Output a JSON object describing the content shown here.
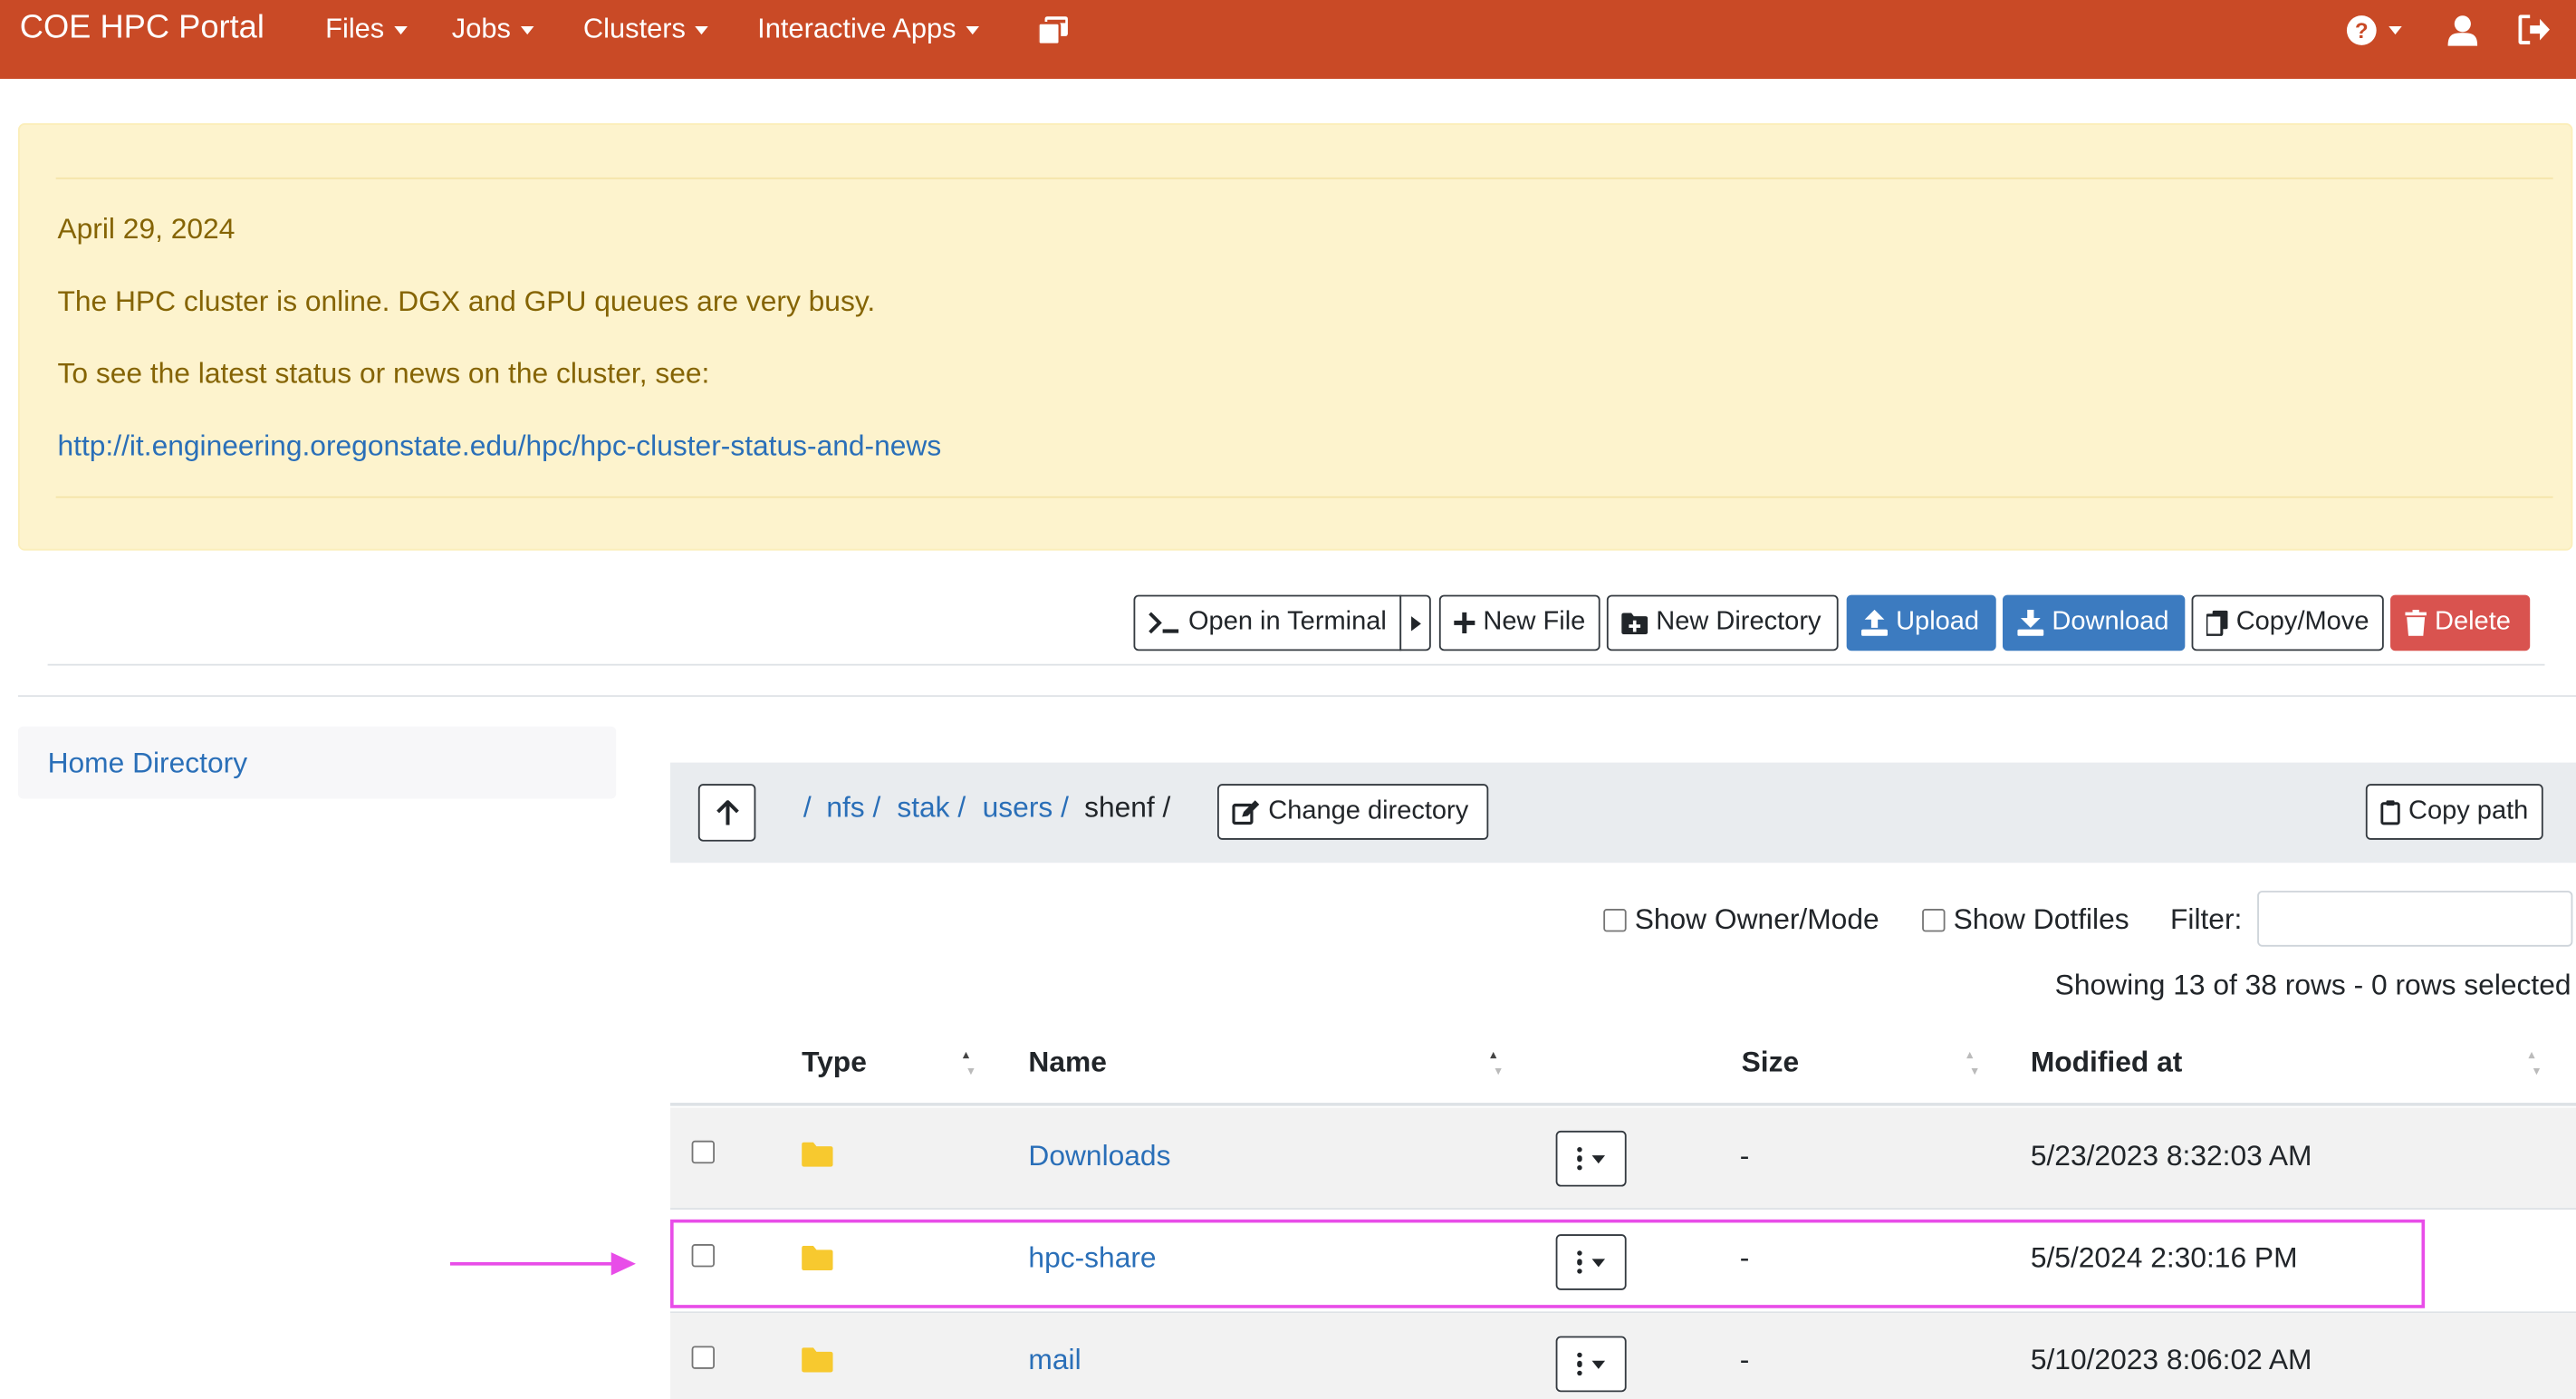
{
  "navbar": {
    "brand": "COE HPC Portal",
    "menus": [
      "Files",
      "Jobs",
      "Clusters",
      "Interactive Apps"
    ],
    "icons": [
      "windows-icon",
      "help-icon",
      "user-icon",
      "logout-icon"
    ],
    "color": "#c94a26"
  },
  "announcement": {
    "date": "April 29, 2024",
    "line1": "The HPC cluster is online. DGX and GPU queues are very busy.",
    "line2": "To see the latest status or news on the cluster, see:",
    "link": "http://it.engineering.oregonstate.edu/hpc/hpc-cluster-status-and-news"
  },
  "toolbar": {
    "open_terminal": "Open in Terminal",
    "new_file": "New File",
    "new_directory": "New Directory",
    "upload": "Upload",
    "download": "Download",
    "copy_move": "Copy/Move",
    "delete": "Delete"
  },
  "sidebar": {
    "home": "Home Directory"
  },
  "breadcrumb": {
    "parts": [
      "/",
      "nfs /",
      "stak /",
      "users /",
      "shenf /"
    ],
    "change_directory": "Change directory",
    "copy_path": "Copy path"
  },
  "filters": {
    "show_owner_mode": "Show Owner/Mode",
    "show_dotfiles": "Show Dotfiles",
    "filter_label": "Filter:",
    "filter_value": ""
  },
  "status": "Showing 13 of 38 rows - 0 rows selected",
  "table": {
    "headers": [
      "Type",
      "Name",
      "Size",
      "Modified at"
    ],
    "rows": [
      {
        "name": "Downloads",
        "size": "-",
        "modified": "5/23/2023 8:32:03 AM"
      },
      {
        "name": "hpc-share",
        "size": "-",
        "modified": "5/5/2024 2:30:16 PM"
      },
      {
        "name": "mail",
        "size": "-",
        "modified": "5/10/2023 8:06:02 AM"
      }
    ]
  },
  "highlight_color": "#e84de8",
  "folder_color": "#f7c92f"
}
